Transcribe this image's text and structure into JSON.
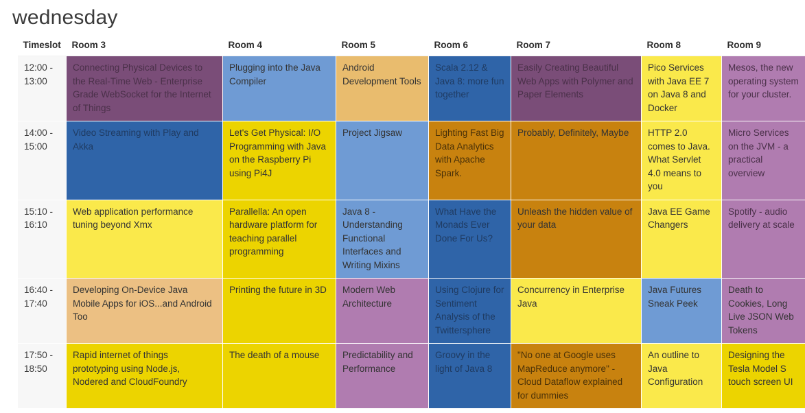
{
  "header": {
    "day_title": "wednesday"
  },
  "table": {
    "columns": [
      "Timeslot",
      "Room 3",
      "Room 4",
      "Room 5",
      "Room 6",
      "Room 7",
      "Room 8",
      "Room 9"
    ],
    "rows": [
      {
        "timeslot": "12:00 - 13:00",
        "cells": [
          {
            "title": "Connecting Physical Devices to the Real-Time Web - Enterprise Grade WebSocket for the Internet of Things",
            "color": "#7a4d78",
            "style": "c-purple"
          },
          {
            "title": "Plugging into the Java Compiler",
            "color": "#6f9bd4",
            "style": "c-lightblue c-dark-text"
          },
          {
            "title": "Android Development Tools",
            "color": "#e9bc6e",
            "style": "c-tan c-dark-text"
          },
          {
            "title": "Scala 2.12 & Java 8: more fun together",
            "color": "#2f64a8",
            "style": "c-darkblue"
          },
          {
            "title": "Easily Creating Beautiful Web Apps with Polymer and Paper Elements",
            "color": "#7a4d78",
            "style": "c-purple"
          },
          {
            "title": "Pico Services with Java EE 7 on Java 8 and Docker",
            "color": "#fae94b",
            "style": "c-brightyellow c-dark-text"
          },
          {
            "title": "Mesos, the new operating system for your cluster.",
            "color": "#b07cb0",
            "style": "c-mauve"
          }
        ]
      },
      {
        "timeslot": "14:00 - 15:00",
        "cells": [
          {
            "title": "Video Streaming with Play and Akka",
            "color": "#2f64a8",
            "style": "c-darkblue"
          },
          {
            "title": "Let's Get Physical: I/O Programming with Java on the Raspberry Pi using Pi4J",
            "color": "#ecd400",
            "style": "c-gold c-dark-text"
          },
          {
            "title": "Project Jigsaw",
            "color": "#6f9bd4",
            "style": "c-lightblue c-dark-text"
          },
          {
            "title": "Lighting Fast Big Data Analytics with Apache Spark.",
            "color": "#c8820f",
            "style": "c-orange"
          },
          {
            "title": "Probably, Definitely, Maybe",
            "color": "#c8820f",
            "style": "c-orange c-dark-text"
          },
          {
            "title": "HTTP 2.0 comes to Java. What Servlet 4.0 means to you",
            "color": "#fae94b",
            "style": "c-brightyellow c-dark-text"
          },
          {
            "title": "Micro Services on the JVM - a practical overview",
            "color": "#b07cb0",
            "style": "c-mauve"
          }
        ]
      },
      {
        "timeslot": "15:10 - 16:10",
        "cells": [
          {
            "title": "Web application performance tuning beyond Xmx",
            "color": "#fae94b",
            "style": "c-brightyellow c-dark-text"
          },
          {
            "title": "Parallella: An open hardware platform for teaching parallel programming",
            "color": "#ecd400",
            "style": "c-gold c-dark-text"
          },
          {
            "title": "Java 8 - Understanding Functional Interfaces and Writing Mixins",
            "color": "#6f9bd4",
            "style": "c-lightblue c-dark-text"
          },
          {
            "title": "What Have the Monads Ever Done For Us?",
            "color": "#2f64a8",
            "style": "c-darkblue"
          },
          {
            "title": "Unleash the hidden value of your data",
            "color": "#c8820f",
            "style": "c-orange c-dark-text"
          },
          {
            "title": "Java EE Game Changers",
            "color": "#fae94b",
            "style": "c-brightyellow c-dark-text"
          },
          {
            "title": "Spotify - audio delivery at scale",
            "color": "#b07cb0",
            "style": "c-mauve"
          }
        ]
      },
      {
        "timeslot": "16:40 - 17:40",
        "cells": [
          {
            "title": "Developing On-Device Java Mobile Apps for iOS...and Android Too",
            "color": "#ecc083",
            "style": "c-sand c-dark-text"
          },
          {
            "title": "Printing the future in 3D",
            "color": "#ecd400",
            "style": "c-gold c-dark-text"
          },
          {
            "title": "Modern Web Architecture",
            "color": "#b07cb0",
            "style": "c-mauve c-dark-text"
          },
          {
            "title": "Using Clojure for Sentiment Analysis of the Twittersphere",
            "color": "#2f64a8",
            "style": "c-darkblue"
          },
          {
            "title": "Concurrency in Enterprise Java",
            "color": "#fae94b",
            "style": "c-brightyellow c-dark-text"
          },
          {
            "title": "Java Futures Sneak Peek",
            "color": "#6f9bd4",
            "style": "c-lightblue c-dark-text"
          },
          {
            "title": "Death to Cookies, Long Live JSON Web Tokens",
            "color": "#b07cb0",
            "style": "c-mauve c-dark-text"
          }
        ]
      },
      {
        "timeslot": "17:50 - 18:50",
        "cells": [
          {
            "title": "Rapid internet of things prototyping using Node.js, Nodered and CloudFoundry",
            "color": "#ecd400",
            "style": "c-gold c-dark-text"
          },
          {
            "title": "The death of a mouse",
            "color": "#ecd400",
            "style": "c-gold c-dark-text"
          },
          {
            "title": "Predictability and Performance",
            "color": "#b07cb0",
            "style": "c-mauve c-dark-text"
          },
          {
            "title": "Groovy in the light of Java 8",
            "color": "#2f64a8",
            "style": "c-darkblue"
          },
          {
            "title": "\"No one at Google uses MapReduce anymore\" - Cloud Dataflow explained for dummies",
            "color": "#c8820f",
            "style": "c-orange"
          },
          {
            "title": "An outline to Java Configuration",
            "color": "#fae94b",
            "style": "c-brightyellow c-dark-text"
          },
          {
            "title": "Designing the Tesla Model S touch screen UI",
            "color": "#ecd400",
            "style": "c-gold c-dark-text"
          }
        ]
      }
    ]
  }
}
